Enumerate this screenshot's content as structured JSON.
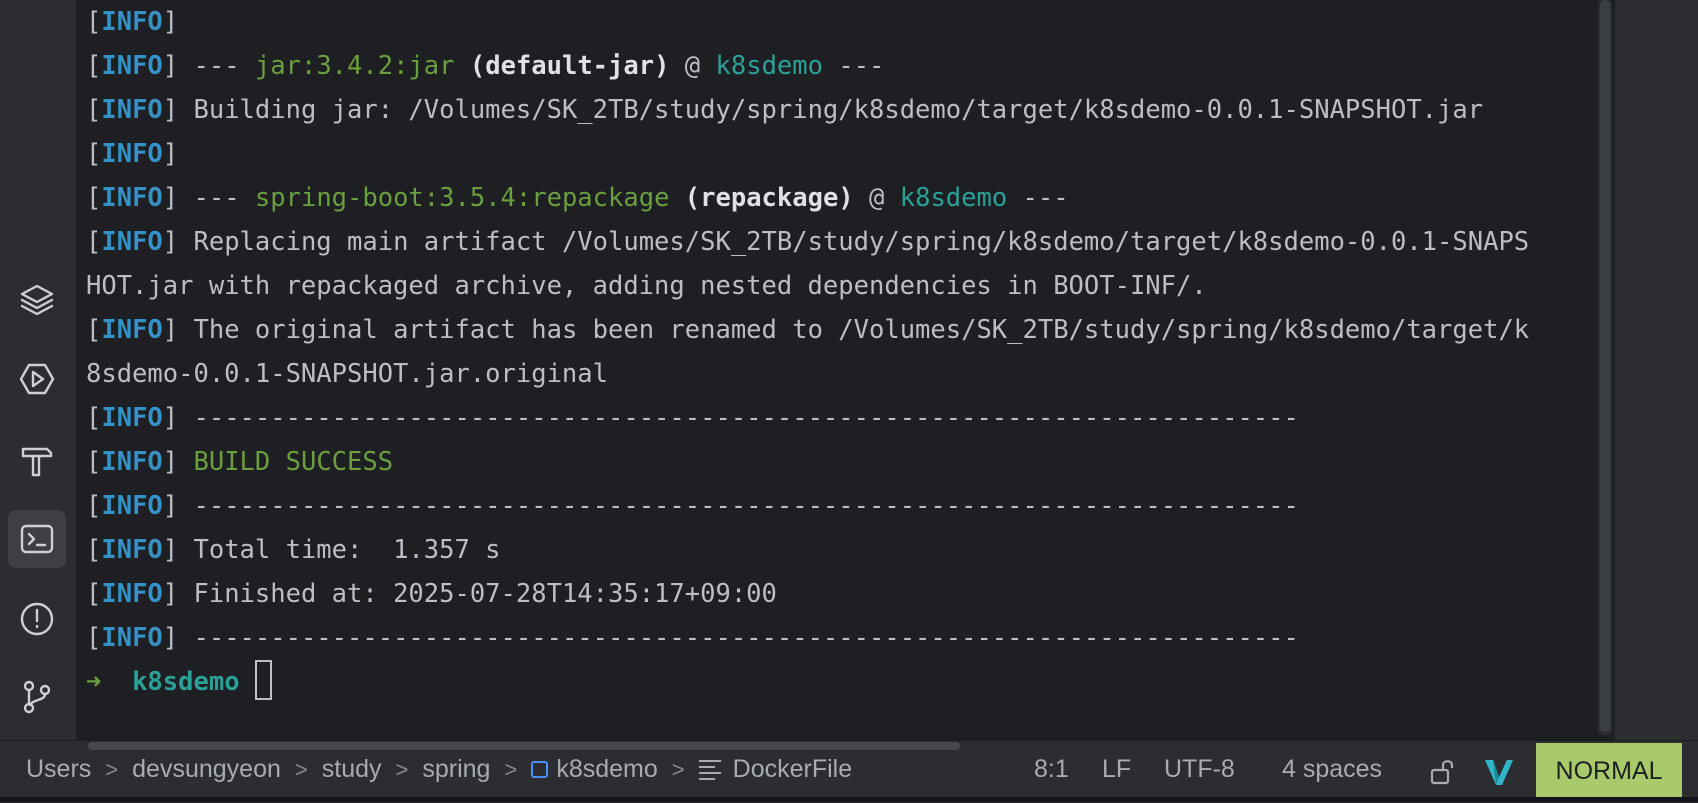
{
  "terminal": {
    "lines": [
      {
        "info": "INFO",
        "segments": [
          {
            "t": "",
            "c": ""
          }
        ]
      },
      {
        "info": "INFO",
        "segments": [
          {
            "t": " --- ",
            "c": ""
          },
          {
            "t": "jar:3.4.2:jar",
            "c": "plugin"
          },
          {
            "t": " ",
            "c": ""
          },
          {
            "t": "(default-jar)",
            "c": "exec"
          },
          {
            "t": " @ ",
            "c": ""
          },
          {
            "t": "k8sdemo",
            "c": "proj"
          },
          {
            "t": " ---",
            "c": ""
          }
        ]
      },
      {
        "info": "INFO",
        "segments": [
          {
            "t": " Building jar: /Volumes/SK_2TB/study/spring/k8sdemo/target/k8sdemo-0.0.1-SNAPSHOT.jar",
            "c": ""
          }
        ]
      },
      {
        "info": "INFO",
        "segments": [
          {
            "t": "",
            "c": ""
          }
        ]
      },
      {
        "info": "INFO",
        "segments": [
          {
            "t": " --- ",
            "c": ""
          },
          {
            "t": "spring-boot:3.5.4:repackage",
            "c": "plugin"
          },
          {
            "t": " ",
            "c": ""
          },
          {
            "t": "(repackage)",
            "c": "exec"
          },
          {
            "t": " @ ",
            "c": ""
          },
          {
            "t": "k8sdemo",
            "c": "proj"
          },
          {
            "t": " ---",
            "c": ""
          }
        ]
      },
      {
        "info": "INFO",
        "segments": [
          {
            "t": " Replacing main artifact /Volumes/SK_2TB/study/spring/k8sdemo/target/k8sdemo-0.0.1-SNAPS",
            "c": ""
          }
        ]
      },
      {
        "info": "",
        "segments": [
          {
            "t": "HOT.jar with repackaged archive, adding nested dependencies in BOOT-INF/.",
            "c": ""
          }
        ]
      },
      {
        "info": "INFO",
        "segments": [
          {
            "t": " The original artifact has been renamed to /Volumes/SK_2TB/study/spring/k8sdemo/target/k",
            "c": ""
          }
        ]
      },
      {
        "info": "",
        "segments": [
          {
            "t": "8sdemo-0.0.1-SNAPSHOT.jar.original",
            "c": ""
          }
        ]
      },
      {
        "info": "INFO",
        "segments": [
          {
            "t": " ------------------------------------------------------------------------",
            "c": ""
          }
        ]
      },
      {
        "info": "INFO",
        "segments": [
          {
            "t": " ",
            "c": ""
          },
          {
            "t": "BUILD SUCCESS",
            "c": "ok"
          }
        ]
      },
      {
        "info": "INFO",
        "segments": [
          {
            "t": " ------------------------------------------------------------------------",
            "c": ""
          }
        ]
      },
      {
        "info": "INFO",
        "segments": [
          {
            "t": " Total time:  1.357 s",
            "c": ""
          }
        ]
      },
      {
        "info": "INFO",
        "segments": [
          {
            "t": " Finished at: 2025-07-28T14:35:17+09:00",
            "c": ""
          }
        ]
      },
      {
        "info": "INFO",
        "segments": [
          {
            "t": " ------------------------------------------------------------------------",
            "c": ""
          }
        ]
      }
    ],
    "prompt": {
      "arrow": "➜",
      "dir": "k8sdemo"
    }
  },
  "left_toolbar": [
    {
      "name": "layers-icon"
    },
    {
      "name": "run-services-icon"
    },
    {
      "name": "build-hammer-icon"
    },
    {
      "name": "terminal-icon",
      "active": true
    },
    {
      "name": "problems-icon"
    },
    {
      "name": "git-icon"
    }
  ],
  "statusbar": {
    "breadcrumbs": [
      "Users",
      "devsungyeon",
      "study",
      "spring",
      "k8sdemo",
      "DockerFile"
    ],
    "position": "8:1",
    "line_separator": "LF",
    "encoding": "UTF-8",
    "indent": "4 spaces",
    "vim_mode": "NORMAL"
  },
  "colors": {
    "accent_mode": "#a9ca6a",
    "info": "#3592c4",
    "success": "#6a9e3f",
    "project": "#2aa198"
  }
}
